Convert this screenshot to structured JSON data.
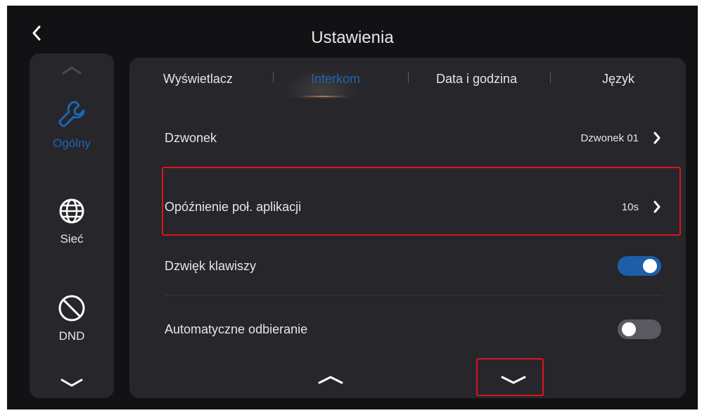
{
  "header": {
    "title": "Ustawienia"
  },
  "sidebar": {
    "items": [
      {
        "label": "Ogólny",
        "icon": "wrench-icon",
        "active": true
      },
      {
        "label": "Sieć",
        "icon": "globe-icon",
        "active": false
      },
      {
        "label": "DND",
        "icon": "do-not-disturb-icon",
        "active": false
      }
    ]
  },
  "tabs": [
    {
      "label": "Wyświetlacz",
      "active": false
    },
    {
      "label": "Interkom",
      "active": true
    },
    {
      "label": "Data i godzina",
      "active": false
    },
    {
      "label": "Język",
      "active": false
    }
  ],
  "settings": {
    "ringtone": {
      "label": "Dzwonek",
      "value": "Dzwonek 01"
    },
    "app_delay": {
      "label": "Opóźnienie poł. aplikacji",
      "value": "10s"
    },
    "key_sound": {
      "label": "Dzwięk klawiszy",
      "enabled": true
    },
    "auto_answer": {
      "label": "Automatyczne odbieranie",
      "enabled": false
    }
  },
  "colors": {
    "accent": "#1f65b1",
    "background": "#121215",
    "panel": "#26262b",
    "highlight_box": "#e0121e",
    "toggle_on": "#1d5ea8",
    "toggle_off": "#5a5a60"
  }
}
